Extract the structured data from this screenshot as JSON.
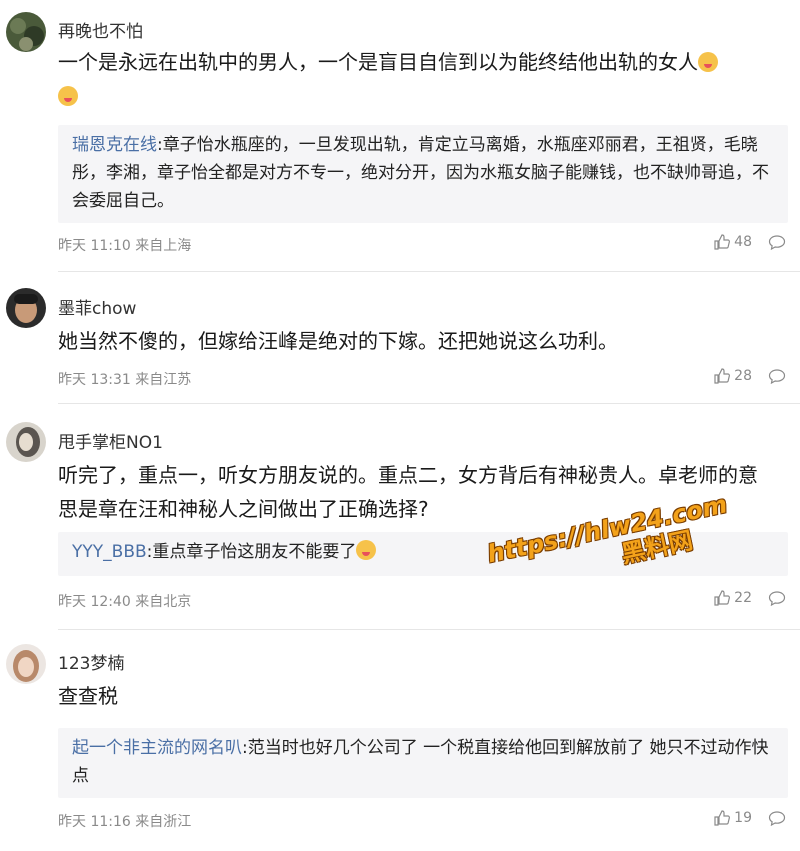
{
  "comments": [
    {
      "username": "再晚也不怕",
      "text": "一个是永远在出轨中的男人，一个是盲目自信到以为能终结他出轨的女人",
      "reply_user": "瑞恩克在线",
      "reply_text": ":章子怡水瓶座的，一旦发现出轨，肯定立马离婚，水瓶座邓丽君，王祖贤，毛晓彤，李湘，章子怡全都是对方不专一，绝对分开，因为水瓶女脑子能赚钱，也不缺帅哥追，不会委屈自己。",
      "meta": "昨天 11:10 来自上海",
      "likes": "48"
    },
    {
      "username": "墨菲chow",
      "text": "她当然不傻的，但嫁给汪峰是绝对的下嫁。还把她说这么功利。",
      "meta": "昨天 13:31 来自江苏",
      "likes": "28"
    },
    {
      "username": "甩手掌柜NO1",
      "text": "听完了，重点一，听女方朋友说的。重点二，女方背后有神秘贵人。卓老师的意思是章在汪和神秘人之间做出了正确选择?",
      "reply_user": "YYY_BBB",
      "reply_text": ":重点章子怡这朋友不能要了",
      "meta": "昨天 12:40 来自北京",
      "likes": "22"
    },
    {
      "username": "123梦楠",
      "text": "查查税",
      "reply_user": "起一个非主流的网名叭",
      "reply_text": ":范当时也好几个公司了 一个税直接给他回到解放前了 她只不过动作快点",
      "meta": "昨天 11:16 来自浙江",
      "likes": "19"
    }
  ],
  "watermark": {
    "line1": "https://hlw24.com",
    "line2": "黑料网"
  }
}
